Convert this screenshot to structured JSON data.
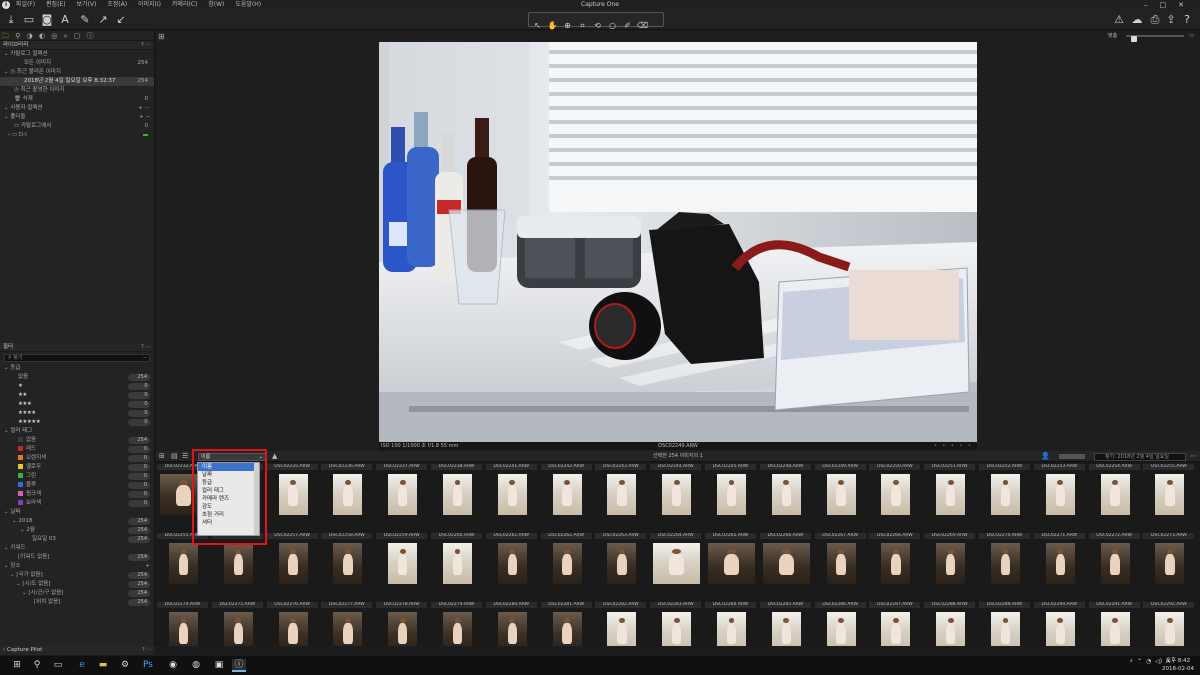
{
  "window": {
    "title": "Capture One",
    "app_logo": "i"
  },
  "menu": [
    "파일(F)",
    "편집(E)",
    "보기(V)",
    "조정(A)",
    "이미지(I)",
    "카메라(C)",
    "창(W)",
    "도움말(H)"
  ],
  "window_controls": [
    "–",
    "□",
    "✕"
  ],
  "toolbar": {
    "left_icons": [
      "import-icon",
      "export-icon",
      "camera-icon",
      "text-icon",
      "brush-icon",
      "cursor-up-icon",
      "cursor-down-icon"
    ],
    "center_tools": [
      "pointer-tool-icon",
      "hand-tool-icon",
      "loupe-tool-icon",
      "crop-tool-icon",
      "rotate-tool-icon",
      "circle-tool-icon",
      "picker-tool-icon",
      "eraser-tool-icon"
    ],
    "right_icons": [
      "warning-icon",
      "proof-icon",
      "print-icon",
      "share-icon",
      "help-icon"
    ]
  },
  "tool_tabs": [
    "🗀",
    "⚲",
    "◑",
    "◐",
    "◎",
    "⌕",
    "▢",
    "ⓘ"
  ],
  "library": {
    "title": "라이브러리",
    "catalog": {
      "title": "카탈로그 컬렉션",
      "all_images": {
        "label": "모든 이미지",
        "count": "254"
      }
    },
    "recent_imports": {
      "title": "최근 불러온 이미지",
      "item": {
        "label": "2018년 2월 4일 일요일 오후 8:32:37",
        "count": "254"
      }
    },
    "recent_captures": "최근 촬영한 이미지",
    "trash": {
      "label": "삭제",
      "count": "0"
    },
    "user_collections": "사용자 컬렉션",
    "folders": {
      "title": "폴더들",
      "catalog_folder": {
        "label": "카탈로그에서",
        "count": "0"
      },
      "drive": "D:\\"
    }
  },
  "filters": {
    "title": "필터",
    "search_placeholder": "찾기",
    "rating": {
      "title": "등급",
      "rows": [
        {
          "label": "없음",
          "count": "254"
        },
        {
          "label": "★",
          "count": "0"
        },
        {
          "label": "★★",
          "count": "0"
        },
        {
          "label": "★★★",
          "count": "0"
        },
        {
          "label": "★★★★",
          "count": "0"
        },
        {
          "label": "★★★★★",
          "count": "0"
        }
      ]
    },
    "color_tag": {
      "title": "컬러 태그",
      "rows": [
        {
          "label": "없음",
          "count": "254",
          "color": "#3a3a3a"
        },
        {
          "label": "레드",
          "count": "0",
          "color": "#c8252b"
        },
        {
          "label": "오렌지색",
          "count": "0",
          "color": "#e07a1f"
        },
        {
          "label": "옐로우",
          "count": "0",
          "color": "#e6c922"
        },
        {
          "label": "그린",
          "count": "0",
          "color": "#3fae3a"
        },
        {
          "label": "블루",
          "count": "0",
          "color": "#2f6fd6"
        },
        {
          "label": "핑크색",
          "count": "0",
          "color": "#d45fb3"
        },
        {
          "label": "보라색",
          "count": "0",
          "color": "#7e3fc4"
        }
      ]
    },
    "date": {
      "title": "날짜",
      "year": {
        "label": "2018",
        "count": "254"
      },
      "month": {
        "label": "2월",
        "count": "254"
      },
      "day": {
        "label": "일요일 03",
        "count": "254"
      }
    },
    "keywords": {
      "title": "키워드",
      "item": {
        "label": "[키워드 없음]",
        "count": "254"
      }
    },
    "places": {
      "title": "장소",
      "rows": [
        {
          "label": "[국가 없음]",
          "count": "254"
        },
        {
          "label": "[시/도 없음]",
          "count": "254"
        },
        {
          "label": "[시/군/구 없음]",
          "count": "254"
        },
        {
          "label": "[위치 없음]",
          "count": "254"
        }
      ]
    }
  },
  "capture_pilot": "Capture Pilot",
  "viewer": {
    "photo_info": "ISO 100  1/1000 초  f/1.8  55 mm",
    "filename": "DSC02249.ARW",
    "zoom_label": "맞춤",
    "zoom_level": 0.1
  },
  "browser": {
    "sort_value": "이름",
    "sort_options": [
      "이름",
      "날짜",
      "등급",
      "컬러 태그",
      "카메라 렌즈",
      "감도",
      "초점 거리",
      "셔터"
    ],
    "selection_count": "선택한 254 이미지의 1",
    "search_text": "찾기: 2018년 2월 4일 일요일",
    "rows": [
      [
        "DSC02232.ARW",
        "DSC02233.ARW",
        "DSC02235.ARW",
        "DSC02236.ARW",
        "DSC02237.ARW",
        "DSC02238.ARW",
        "DSC02241.ARW",
        "DSC02242.ARW",
        "DSC02243.ARW",
        "DSC02244.ARW",
        "DSC02245.ARW",
        "DSC02248.ARW",
        "DSC02249.ARW",
        "DSC02250.ARW",
        "DSC02251.ARW",
        "DSC02252.ARW",
        "DSC02253.ARW",
        "DSC02254.ARW",
        "DSC02255.ARW"
      ],
      [
        "DSC02255.ARW",
        "DSC02256.ARW",
        "DSC02257.ARW",
        "DSC02258.ARW",
        "DSC02259.ARW",
        "DSC02260.ARW",
        "DSC02261.ARW",
        "DSC02262.ARW",
        "DSC02263.ARW",
        "DSC02264.ARW",
        "DSC02265.ARW",
        "DSC02266.ARW",
        "DSC02267.ARW",
        "DSC02268.ARW",
        "DSC02269.ARW",
        "DSC02270.ARW",
        "DSC02271.ARW",
        "DSC02272.ARW",
        "DSC02273.ARW"
      ],
      [
        "DSC02274.ARW",
        "DSC02275.ARW",
        "DSC02276.ARW",
        "DSC02277.ARW",
        "DSC02278.ARW",
        "DSC02279.ARW",
        "DSC02280.ARW",
        "DSC02281.ARW",
        "DSC02282.ARW",
        "DSC02283.ARW",
        "DSC02284.ARW",
        "DSC02285.ARW",
        "DSC02286.ARW",
        "DSC02287.ARW",
        "DSC02288.ARW",
        "DSC02289.ARW",
        "DSC02290.ARW",
        "DSC02291.ARW",
        "DSC02292.ARW"
      ]
    ]
  },
  "taskbar": {
    "icons": [
      "windows-start-icon",
      "search-icon",
      "task-view-icon",
      "edge-icon",
      "explorer-icon",
      "settings-icon",
      "photoshop-icon",
      "chrome-icon",
      "capture-one-icon",
      "photos-icon",
      "capture-one-active-icon"
    ],
    "input_indicator": "A",
    "time": "오후 8:42",
    "date": "2018-02-04"
  }
}
